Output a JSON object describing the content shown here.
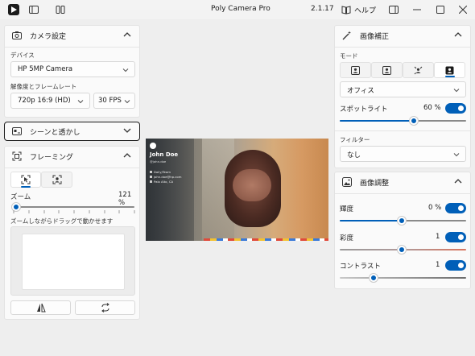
{
  "app": {
    "title": "Poly Camera Pro",
    "version": "2.1.17",
    "help_label": "ヘルプ"
  },
  "colors": {
    "accent": "#005fb8",
    "background": "#eeeeee",
    "panel": "#fafafa"
  },
  "camera_settings": {
    "title": "カメラ設定",
    "device_label": "デバイス",
    "device_value": "HP 5MP Camera",
    "resolution_label": "解像度とフレームレート",
    "resolution_value": "720p 16:9 (HD)",
    "fps_value": "30 FPS"
  },
  "scene_transparency": {
    "title": "シーンと透かし"
  },
  "framing": {
    "title": "フレーミング",
    "zoom_label": "ズーム",
    "zoom_value": "121 %",
    "zoom_level": 0.05,
    "zoom_hint": "ズームしながらドラッグで動かせます"
  },
  "preview": {
    "name": "John Doe",
    "handle": "@john.doe",
    "lines": [
      "Daily/Team",
      "john.doe@hp.com",
      "Palo Alto, CA"
    ]
  },
  "image_correction": {
    "title": "画像補正",
    "mode_label": "モード",
    "mode_value": "オフィス",
    "spotlight_label": "スポットライト",
    "spotlight_value": "60 %",
    "spotlight_level": 0.6,
    "filter_label": "フィルター",
    "filter_value": "なし"
  },
  "image_adjust": {
    "title": "画像調整",
    "brightness_label": "輝度",
    "brightness_value": "0 %",
    "saturation_label": "彩度",
    "saturation_value": "1",
    "contrast_label": "コントラスト",
    "contrast_value": "1"
  }
}
